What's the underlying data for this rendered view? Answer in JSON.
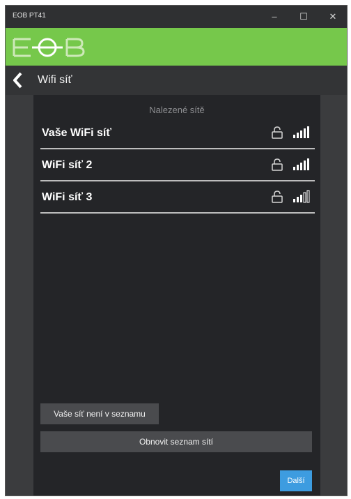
{
  "window": {
    "title": "EOB PT41"
  },
  "brand": {
    "logo_text": "EOB",
    "color": "#76c84b"
  },
  "nav": {
    "title": "Wifi síť"
  },
  "networks": {
    "heading": "Nalezené sítě",
    "items": [
      {
        "name": "Vaše WiFi síť",
        "locked": true,
        "signal_bars": 5
      },
      {
        "name": "WiFi síť 2",
        "locked": true,
        "signal_bars": 5
      },
      {
        "name": "WiFi síť 3",
        "locked": true,
        "signal_bars": 3
      }
    ]
  },
  "actions": {
    "not_listed_label": "Vaše síť není v seznamu",
    "refresh_label": "Obnovit seznam sítí",
    "next_label": "Další"
  },
  "colors": {
    "accent_button": "#3d9ce0"
  }
}
